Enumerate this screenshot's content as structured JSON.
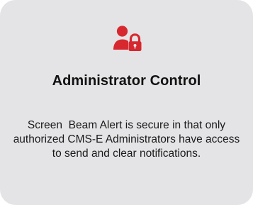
{
  "card": {
    "icon": "user-lock-icon",
    "accent_color": "#d7282f",
    "background_color": "#e4e4e6",
    "title": "Administrator Control",
    "description": "Screen  Beam Alert is secure in that only authorized CMS-E Administrators have access to send and clear notifications."
  }
}
